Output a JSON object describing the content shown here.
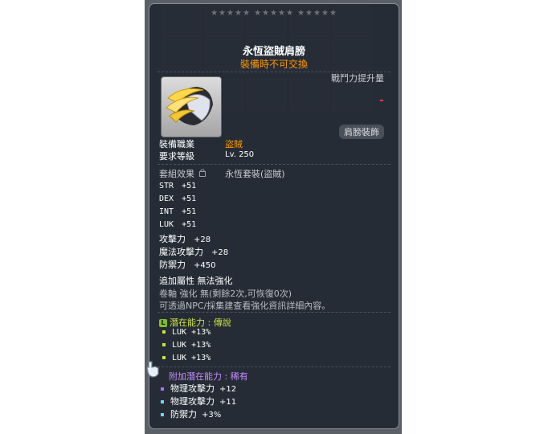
{
  "item": {
    "name": "永恆盜賊肩膀",
    "trade_note": "裝備時不可交換",
    "power_label": "戰鬥力提升量",
    "power_value": "-",
    "category": "肩膀裝飾",
    "job_label": "裝備職業",
    "job_value": "盜賊",
    "level_label": "要求等級",
    "level_value": "Lv. 250",
    "set_label": "套組效果",
    "set_value": "永恆套裝(盜賊)"
  },
  "stats": [
    {
      "name": "STR",
      "value": "+51"
    },
    {
      "name": "DEX",
      "value": "+51"
    },
    {
      "name": "INT",
      "value": "+51"
    },
    {
      "name": "LUK",
      "value": "+51"
    },
    {
      "name": "攻擊力",
      "value": "+28"
    },
    {
      "name": "魔法攻擊力",
      "value": "+28"
    },
    {
      "name": "防禦力",
      "value": "+450"
    }
  ],
  "extra": {
    "label": "追加屬性 無法強化",
    "scroll": "卷軸 強化 無(剩餘2次,可恢復0次)",
    "npc_note": "可透過NPC/採集建查看強化資訊詳細內容。"
  },
  "potential": {
    "label": "潛在能力 : 傳說",
    "badge": "L",
    "lines": [
      "LUK +13%",
      "LUK +13%",
      "LUK +13%"
    ]
  },
  "bonus_potential": {
    "label": "附加潛在能力 : 稀有",
    "lines": [
      {
        "name": "物理攻擊力",
        "value": "+12"
      },
      {
        "name": "物理攻擊力",
        "value": "+11"
      },
      {
        "name": "防禦力",
        "value": "+3%"
      }
    ]
  },
  "colors": {
    "job": "#ff9900",
    "trade_note": "#ff9900",
    "power_value": "#ff3355",
    "potential": "#cce045",
    "bonus": "#c58cff",
    "bonus_bullet": "#b86cff",
    "bonus_bullet_alt": "#6fd5ff"
  },
  "icons": [
    "shoulder-armor-icon",
    "lock-icon",
    "cursor-hand-icon"
  ]
}
